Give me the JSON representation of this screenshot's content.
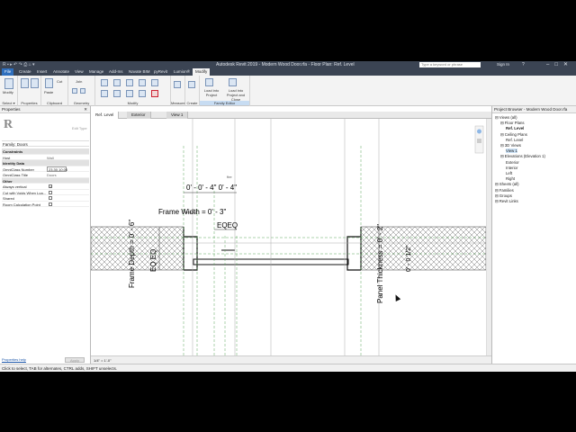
{
  "window": {
    "title": "Autodesk Revit 2019 - Modern Wood Door.rfa - Floor Plan: Ref. Level",
    "search_placeholder": "Type a keyword or phrase",
    "user": "Sign In",
    "help": "?"
  },
  "tabs": [
    "File",
    "Create",
    "Insert",
    "Annotate",
    "View",
    "Manage",
    "Add-Ins",
    "Navate BIM",
    "pyRevit",
    "Lumion®",
    "Modify"
  ],
  "ribbon": {
    "groups": [
      "Select ▾",
      "Properties",
      "Clipboard",
      "Geometry",
      "Modify",
      "Measure",
      "Create",
      "Family Editor"
    ],
    "buttons": {
      "modify": "Modify",
      "paste": "Paste",
      "cut": "Cut",
      "join": "Join",
      "load_project": "Load into Project",
      "load_close": "Load into Project and Close"
    }
  },
  "properties": {
    "header": "Properties",
    "family": "Family: Doors",
    "edit_type": "Edit Type",
    "rows": [
      {
        "k": "Constraints",
        "v": "",
        "sec": true
      },
      {
        "k": "Host",
        "v": "Wall"
      },
      {
        "k": "Identity Data",
        "v": "",
        "sec": true
      },
      {
        "k": "OmniClass Number",
        "v": "23.30.10.00",
        "box": true
      },
      {
        "k": "OmniClass Title",
        "v": "Doors"
      },
      {
        "k": "Other",
        "v": "",
        "sec": true
      },
      {
        "k": "Always vertical",
        "cb": true,
        "checked": true
      },
      {
        "k": "Cut with Voids When Loa...",
        "cb": true,
        "checked": false
      },
      {
        "k": "Shared",
        "cb": true,
        "checked": false
      },
      {
        "k": "Room Calculation Point",
        "cb": true,
        "checked": false
      }
    ],
    "help_link": "Properties help",
    "apply": "Apply"
  },
  "view_tabs": [
    "Ref. Level",
    "Exterior",
    "View 1"
  ],
  "drawing": {
    "dims": {
      "top": "0' - 0' - 4\" 0' - 4\"",
      "frame_width": "Frame Width = 0' - 3\"",
      "eqeq": "EQEQ",
      "frame_depth": "Frame Depth = 0' - 6\"",
      "eq_left": "EQ EQ",
      "panel_thickness": "Panel Thickness = 0' - 2\"",
      "right_small": "0' - 0 1/2\"",
      "fire": "fire"
    }
  },
  "view_control": {
    "scale": "1/4\" = 1'-0\""
  },
  "project_browser": {
    "header": "Project Browser - Modern Wood Door.rfa",
    "nodes": [
      {
        "t": "Views (all)",
        "lvl": 0
      },
      {
        "t": "Floor Plans",
        "lvl": 1
      },
      {
        "t": "Ref. Level",
        "lvl": 2,
        "bold": true
      },
      {
        "t": "Ceiling Plans",
        "lvl": 1
      },
      {
        "t": "Ref. Level",
        "lvl": 2
      },
      {
        "t": "3D Views",
        "lvl": 1
      },
      {
        "t": "View 1",
        "lvl": 2,
        "sel": true
      },
      {
        "t": "Elevations (Elevation 1)",
        "lvl": 1
      },
      {
        "t": "Exterior",
        "lvl": 2
      },
      {
        "t": "Interior",
        "lvl": 2
      },
      {
        "t": "Left",
        "lvl": 2
      },
      {
        "t": "Right",
        "lvl": 2
      },
      {
        "t": "Sheets (all)",
        "lvl": 0
      },
      {
        "t": "Families",
        "lvl": 0
      },
      {
        "t": "Groups",
        "lvl": 0
      },
      {
        "t": "Revit Links",
        "lvl": 0
      }
    ]
  },
  "status": "Click to select, TAB for alternates, CTRL adds, SHIFT unselects.",
  "colors": {
    "title_bg": "#3b4453",
    "file_tab": "#2f6fbd",
    "family_editor": "#c7dcf2"
  }
}
